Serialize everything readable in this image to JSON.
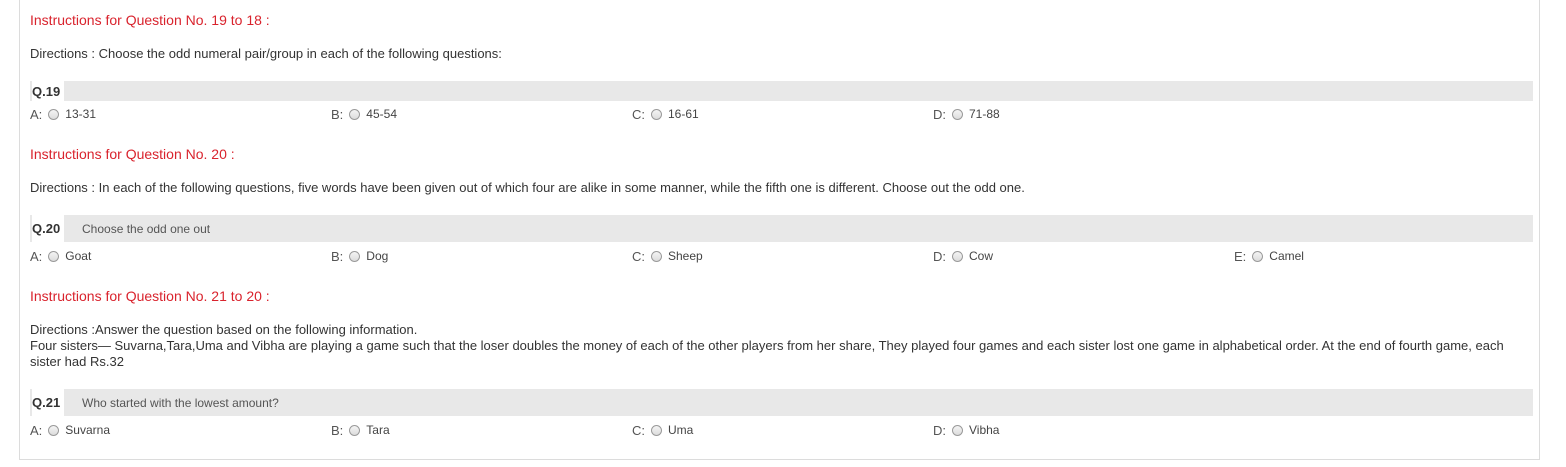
{
  "sections": [
    {
      "instructions": "Instructions for Question No. 19 to 18 :",
      "directions": "Directions : Choose the odd numeral pair/group in each of the following questions:",
      "question": {
        "number": "Q.19",
        "text": "",
        "options": [
          {
            "letter": "A:",
            "text": "13-31"
          },
          {
            "letter": "B:",
            "text": "45-54"
          },
          {
            "letter": "C:",
            "text": "16-61"
          },
          {
            "letter": "D:",
            "text": "71-88"
          }
        ]
      }
    },
    {
      "instructions": "Instructions for Question No. 20 :",
      "directions": "Directions : In each of the following questions, five words have been given out of which four are alike in some manner, while the fifth one is different. Choose out the odd one.",
      "question": {
        "number": "Q.20",
        "text": "Choose the odd one out",
        "options": [
          {
            "letter": "A:",
            "text": "Goat"
          },
          {
            "letter": "B:",
            "text": "Dog"
          },
          {
            "letter": "C:",
            "text": "Sheep"
          },
          {
            "letter": "D:",
            "text": "Cow"
          },
          {
            "letter": "E:",
            "text": "Camel"
          }
        ]
      }
    },
    {
      "instructions": "Instructions for Question No. 21 to 20 :",
      "directions_line1": "Directions :Answer the question based on the following information.",
      "directions_line2": "Four sisters— Suvarna,Tara,Uma and Vibha are playing a game such that the loser doubles the money of each of the other players from her share, They played four games and each sister lost one game in alphabetical order. At the end of fourth game, each sister had Rs.32",
      "question": {
        "number": "Q.21",
        "text": "Who started with the lowest amount?",
        "options": [
          {
            "letter": "A:",
            "text": "Suvarna"
          },
          {
            "letter": "B:",
            "text": "Tara"
          },
          {
            "letter": "C:",
            "text": "Uma"
          },
          {
            "letter": "D:",
            "text": "Vibha"
          }
        ]
      }
    }
  ],
  "colors": {
    "instructions_red": "#d9232d",
    "question_bar_gray": "#e8e8e8"
  }
}
